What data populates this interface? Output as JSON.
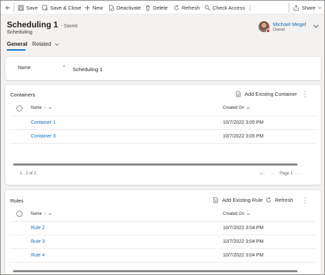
{
  "toolbar": {
    "save": "Save",
    "save_close": "Save & Close",
    "new": "New",
    "deactivate": "Deactivate",
    "delete": "Delete",
    "refresh": "Refresh",
    "check_access": "Check Access",
    "share": "Share"
  },
  "header": {
    "title": "Scheduling 1",
    "saved": "- Saved",
    "entity": "Scheduling",
    "owner_name": "Michael Megel",
    "owner_role": "Owner"
  },
  "tabs": {
    "general": "General",
    "related": "Related"
  },
  "form": {
    "name_label": "Name",
    "required_mark": "*",
    "name_value": "Scheduling 1"
  },
  "containers": {
    "title": "Containers",
    "add_existing": "Add Existing Container",
    "col_name": "Name",
    "col_created": "Created On",
    "rows": [
      {
        "name": "Container 1",
        "created": "10/7/2022 3:05 PM"
      },
      {
        "name": "Container 3",
        "created": "10/7/2022 3:05 PM"
      }
    ],
    "footer_count": "1 - 2 of 2",
    "page": "Page 1"
  },
  "rules": {
    "title": "Rules",
    "add_existing": "Add Existing Rule",
    "refresh": "Refresh",
    "col_name": "Name",
    "col_created": "Created On",
    "rows": [
      {
        "name": "Rule 2",
        "created": "10/7/2022 3:04 PM"
      },
      {
        "name": "Rule 3",
        "created": "10/7/2022 3:04 PM"
      },
      {
        "name": "Rule 4",
        "created": "10/7/2022 3:04 PM"
      }
    ]
  },
  "colors": {
    "accent": "#0f6cbd",
    "required": "#a4262c",
    "presence_busy": "#c4314b",
    "page_bg": "#f3f2f1"
  },
  "icons": [
    "back-arrow-icon",
    "save-icon",
    "save-close-icon",
    "plus-icon",
    "deactivate-icon",
    "delete-icon",
    "refresh-icon",
    "check-access-icon",
    "share-icon",
    "chevron-down-icon",
    "more-icon",
    "add-existing-icon",
    "sort-arrow-icon",
    "first-page-icon",
    "previous-page-icon",
    "next-page-icon"
  ]
}
